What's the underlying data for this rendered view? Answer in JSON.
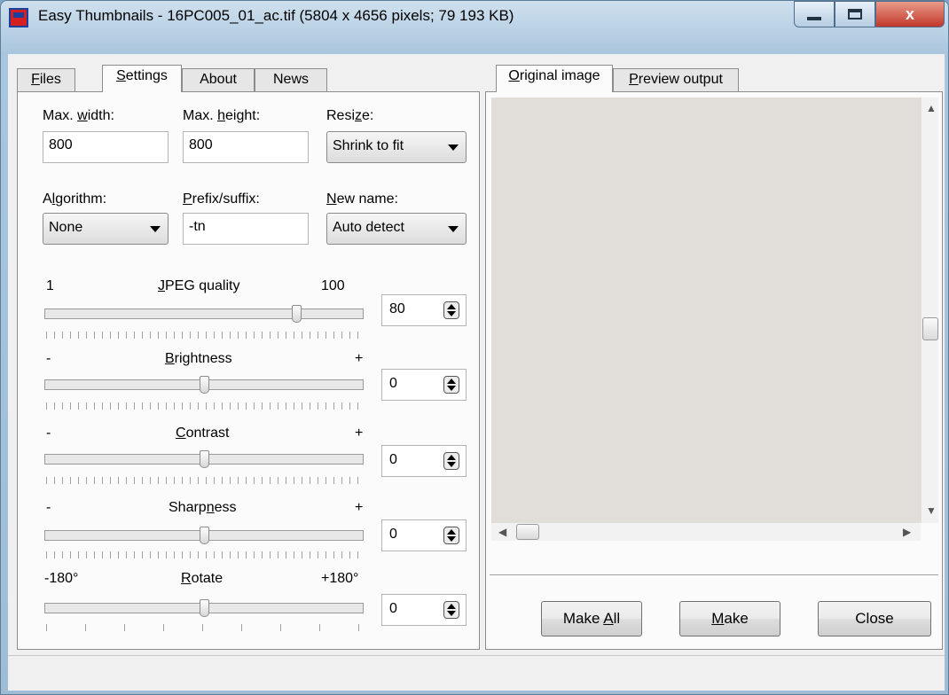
{
  "window": {
    "title": "Easy Thumbnails - 16PC005_01_ac.tif  (5804 x 4656 pixels;  79 193 KB)",
    "close_glyph": "x"
  },
  "left_tabs": [
    {
      "prefix": "",
      "u": "F",
      "suffix": "iles"
    },
    {
      "prefix": "",
      "u": "S",
      "suffix": "ettings"
    },
    {
      "prefix": "About",
      "u": "",
      "suffix": ""
    },
    {
      "prefix": "News",
      "u": "",
      "suffix": ""
    }
  ],
  "settings": {
    "max_width": {
      "label_pre": "Max. ",
      "label_u": "w",
      "label_post": "idth:",
      "value": "800"
    },
    "max_height": {
      "label_pre": "Max. ",
      "label_u": "h",
      "label_post": "eight:",
      "value": "800"
    },
    "resize": {
      "label_pre": "Resi",
      "label_u": "z",
      "label_post": "e:",
      "value": "Shrink to fit"
    },
    "algorithm": {
      "label_pre": "A",
      "label_u": "l",
      "label_post": "gorithm:",
      "value": "None"
    },
    "prefix_suffix": {
      "label_pre": "",
      "label_u": "P",
      "label_post": "refix/suffix:",
      "value": "-tn"
    },
    "new_name": {
      "label_pre": "",
      "label_u": "N",
      "label_post": "ew name:",
      "value": "Auto detect"
    }
  },
  "sliders": {
    "jpeg": {
      "min_label": "1",
      "title_pre": "",
      "title_u": "J",
      "title_post": "PEG quality",
      "max_label": "100",
      "value": "80",
      "level_percent": 80
    },
    "brightness": {
      "min_label": "-",
      "title_pre": "",
      "title_u": "B",
      "title_post": "rightness",
      "max_label": "+",
      "value": "0",
      "level_percent": 50
    },
    "contrast": {
      "min_label": "-",
      "title_pre": "",
      "title_u": "C",
      "title_post": "ontrast",
      "max_label": "+",
      "value": "0",
      "level_percent": 50
    },
    "sharpness": {
      "min_label": "-",
      "title_pre": "Sharp",
      "title_u": "n",
      "title_post": "ess",
      "max_label": "+",
      "value": "0",
      "level_percent": 50
    },
    "rotate": {
      "min_label": "-180°",
      "title_pre": "",
      "title_u": "R",
      "title_post": "otate",
      "max_label": "+180°",
      "value": "0",
      "level_percent": 50
    }
  },
  "right_tabs": [
    {
      "prefix": "",
      "u": "O",
      "suffix": "riginal image"
    },
    {
      "prefix": "",
      "u": "P",
      "suffix": "review output"
    }
  ],
  "buttons": {
    "make_all": {
      "pre": "Make ",
      "u": "A",
      "post": "ll"
    },
    "make": {
      "pre": "",
      "u": "M",
      "post": "ake"
    },
    "close": {
      "pre": "Close",
      "u": "",
      "post": ""
    }
  }
}
